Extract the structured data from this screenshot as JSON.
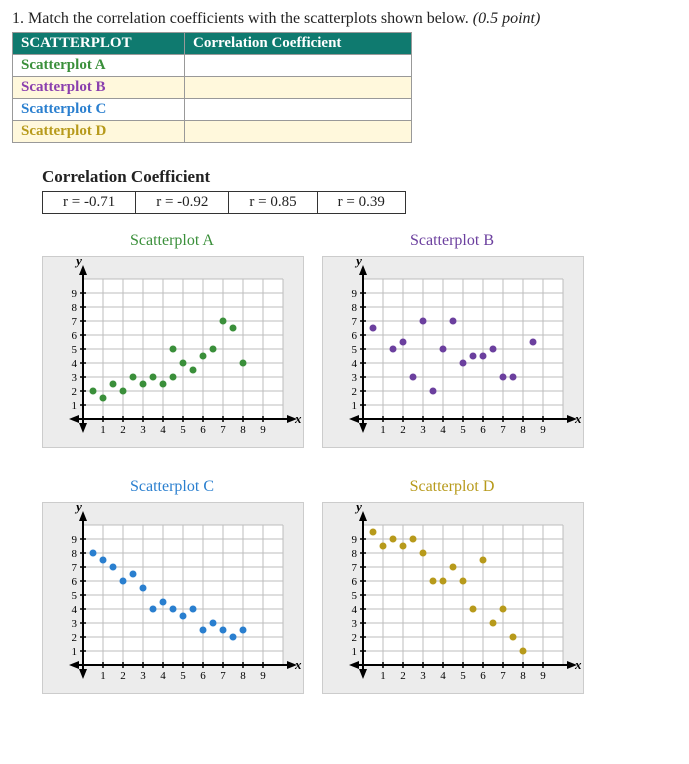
{
  "question": {
    "number": "1.",
    "text": "Match the correlation coefficients with the scatterplots shown below.",
    "points": "(0.5 point)"
  },
  "match_table": {
    "headers": [
      "SCATTERPLOT",
      "Correlation Coefficient"
    ],
    "rows": [
      {
        "key": "A",
        "label": "Scatterplot A",
        "value": ""
      },
      {
        "key": "B",
        "label": "Scatterplot B",
        "value": ""
      },
      {
        "key": "C",
        "label": "Scatterplot C",
        "value": ""
      },
      {
        "key": "D",
        "label": "Scatterplot D",
        "value": ""
      }
    ]
  },
  "coeff_heading": "Correlation Coefficient",
  "coeff_options": [
    "r = -0.71",
    "r = -0.92",
    "r = 0.85",
    "r = 0.39"
  ],
  "axis_labels": {
    "x": "x",
    "y": "y"
  },
  "tick_values": [
    1,
    2,
    3,
    4,
    5,
    6,
    7,
    8,
    9
  ],
  "chart_data": [
    {
      "id": "A",
      "title": "Scatterplot A",
      "type": "scatter",
      "xlim": [
        0,
        10
      ],
      "ylim": [
        0,
        10
      ],
      "points": [
        [
          0.5,
          2
        ],
        [
          1,
          1.5
        ],
        [
          1.5,
          2.5
        ],
        [
          2,
          2
        ],
        [
          2.5,
          3
        ],
        [
          3,
          2.5
        ],
        [
          3.5,
          3
        ],
        [
          4,
          2.5
        ],
        [
          4.5,
          3
        ],
        [
          4.5,
          5
        ],
        [
          5,
          4
        ],
        [
          5.5,
          3.5
        ],
        [
          6,
          4.5
        ],
        [
          6.5,
          5
        ],
        [
          7,
          7
        ],
        [
          7.5,
          6.5
        ],
        [
          8,
          4
        ]
      ]
    },
    {
      "id": "B",
      "title": "Scatterplot B",
      "type": "scatter",
      "xlim": [
        0,
        10
      ],
      "ylim": [
        0,
        10
      ],
      "points": [
        [
          0.5,
          6.5
        ],
        [
          1.5,
          5
        ],
        [
          2,
          5.5
        ],
        [
          2.5,
          3
        ],
        [
          3,
          7
        ],
        [
          3.5,
          2
        ],
        [
          4,
          5
        ],
        [
          4.5,
          7
        ],
        [
          5,
          4
        ],
        [
          5.5,
          4.5
        ],
        [
          6,
          4.5
        ],
        [
          6.5,
          5
        ],
        [
          7,
          3
        ],
        [
          7.5,
          3
        ],
        [
          8.5,
          5.5
        ]
      ]
    },
    {
      "id": "C",
      "title": "Scatterplot C",
      "type": "scatter",
      "xlim": [
        0,
        10
      ],
      "ylim": [
        0,
        10
      ],
      "points": [
        [
          0.5,
          8
        ],
        [
          1,
          7.5
        ],
        [
          1.5,
          7
        ],
        [
          2,
          6
        ],
        [
          2.5,
          6.5
        ],
        [
          3,
          5.5
        ],
        [
          3.5,
          4
        ],
        [
          4,
          4.5
        ],
        [
          4.5,
          4
        ],
        [
          5,
          3.5
        ],
        [
          5.5,
          4
        ],
        [
          6,
          2.5
        ],
        [
          6.5,
          3
        ],
        [
          7,
          2.5
        ],
        [
          7.5,
          2
        ],
        [
          8,
          2.5
        ]
      ]
    },
    {
      "id": "D",
      "title": "Scatterplot D",
      "type": "scatter",
      "xlim": [
        0,
        10
      ],
      "ylim": [
        0,
        10
      ],
      "points": [
        [
          0.5,
          9.5
        ],
        [
          1,
          8.5
        ],
        [
          1.5,
          9
        ],
        [
          2,
          8.5
        ],
        [
          2.5,
          9
        ],
        [
          3,
          8
        ],
        [
          3.5,
          6
        ],
        [
          4,
          6
        ],
        [
          4.5,
          7
        ],
        [
          5,
          6
        ],
        [
          5.5,
          4
        ],
        [
          6,
          7.5
        ],
        [
          6.5,
          3
        ],
        [
          7,
          4
        ],
        [
          7.5,
          2
        ],
        [
          8,
          1
        ]
      ]
    }
  ]
}
